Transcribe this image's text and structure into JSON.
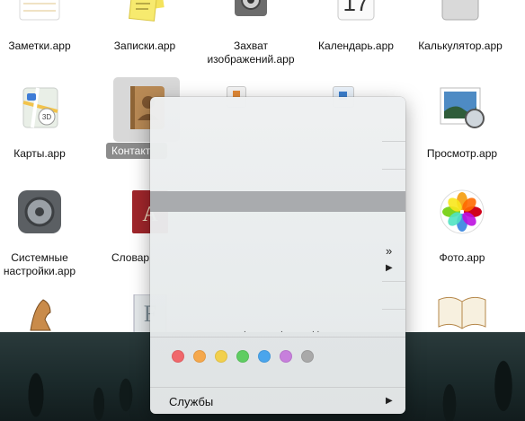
{
  "apps": [
    {
      "label": "Заметки.app",
      "icon": "notes-icon"
    },
    {
      "label": "Записки.app",
      "icon": "stickies-icon"
    },
    {
      "label": "Захват изображений.app",
      "icon": "image-capture-icon"
    },
    {
      "label": "Календарь.app",
      "icon": "calendar-icon"
    },
    {
      "label": "Калькулятор.app",
      "icon": "calculator-icon"
    },
    {
      "label": "Карты.app",
      "icon": "maps-icon"
    },
    {
      "label": "Контакт",
      "icon": "contacts-icon"
    },
    {
      "label": "Просмотр.app",
      "icon": "preview-icon"
    },
    {
      "label": "Системные настройки.app",
      "icon": "system-preferences-icon"
    },
    {
      "label": "Словар",
      "icon": "dictionary-icon"
    },
    {
      "label": "Фото.app",
      "icon": "photos-icon"
    }
  ],
  "calendar_day": "17",
  "dictionary_letter": "A",
  "menu": {
    "overflow_glyph": "»",
    "submenu_glyph": "▶",
    "services_label": "Службы",
    "tag_colors": [
      "#f0676b",
      "#f5a84c",
      "#f2d04d",
      "#5fcd62",
      "#4aa5ec",
      "#c77fdc",
      "#a9a9a9"
    ]
  }
}
